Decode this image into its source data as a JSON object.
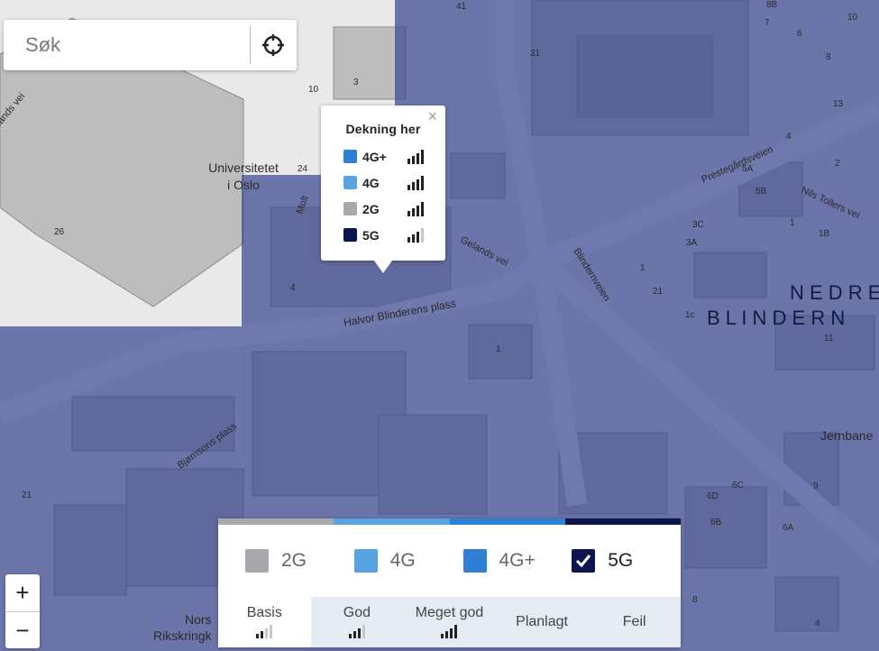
{
  "search": {
    "placeholder": "Søk",
    "locate_icon": "crosshair-icon"
  },
  "popup": {
    "title": "Dekning her",
    "close_icon": "close-icon",
    "rows": [
      {
        "label": "4G+",
        "color": "#2f7fd4",
        "signal": 4
      },
      {
        "label": "4G",
        "color": "#58a3e2",
        "signal": 4
      },
      {
        "label": "2G",
        "color": "#a9a9ad",
        "signal": 4
      },
      {
        "label": "5G",
        "color": "#0d1551",
        "signal": 3
      }
    ]
  },
  "legend": {
    "strip_colors": [
      "#a9a9ad",
      "#58a3e2",
      "#2f7fd4",
      "#0d1551"
    ],
    "items": [
      {
        "label": "2G",
        "color": "#a9a9ad",
        "checked": false
      },
      {
        "label": "4G",
        "color": "#58a3e2",
        "checked": false
      },
      {
        "label": "4G+",
        "color": "#2f7fd4",
        "checked": false
      },
      {
        "label": "5G",
        "color": "#0d1551",
        "checked": true
      }
    ],
    "scale": [
      {
        "label": "Basis",
        "signal": 2
      },
      {
        "label": "God",
        "signal": 3
      },
      {
        "label": "Meget god",
        "signal": 4
      },
      {
        "label": "Planlagt",
        "signal": 0
      },
      {
        "label": "Feil",
        "signal": 0
      }
    ]
  },
  "zoom": {
    "in_label": "+",
    "out_label": "−"
  },
  "map": {
    "coverage_color": "#3c4891",
    "place_labels": {
      "university_line1": "Universitetet",
      "university_line2": "i Oslo",
      "nedre": "N E D R E",
      "blindern": "B L I N D E R N",
      "halvor": "Halvor Blinderens plass",
      "blindernveien": "Blindernveien",
      "prestegard": "Prestegårdsveien",
      "nils": "Nils Tollers vei",
      "gelands": "Gelands vei",
      "bjornson": "Bjørnsons plass",
      "jernbane": "Jernbane",
      "rikskringk": "Rikskringk",
      "norsk": "Nors",
      "lands": "lands vei",
      "molt": "Molt"
    },
    "house_numbers": [
      "41",
      "31",
      "3",
      "10",
      "24",
      "26",
      "4",
      "1",
      "13",
      "7",
      "2",
      "5A",
      "5B",
      "3A",
      "3C",
      "1",
      "1B",
      "1",
      "21",
      "1c",
      "11",
      "6D",
      "6C",
      "6B",
      "6A",
      "8",
      "4",
      "9",
      "21",
      "8",
      "10",
      "8B",
      "6",
      "4"
    ]
  }
}
